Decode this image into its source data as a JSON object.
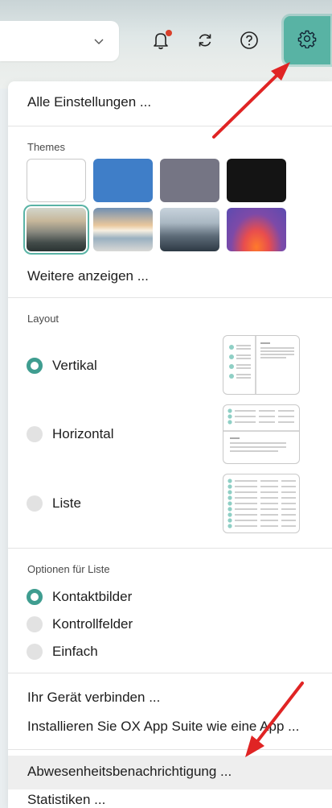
{
  "toolbar": {
    "search_dropdown": "chevron-down-icon",
    "notifications": "bell-icon",
    "refresh": "refresh-icon",
    "help": "help-icon",
    "settings": "gear-icon",
    "accent_color": "#58b3a4",
    "notification_dot_color": "#d9402b"
  },
  "menu": {
    "all_settings": "Alle Einstellungen ...",
    "themes": {
      "label": "Themes",
      "colors": [
        "#ffffff",
        "#3f7ec8",
        "#757584",
        "#141414"
      ],
      "images": [
        "mountains-fog",
        "beach-sunset",
        "city-skyline",
        "purple-orange-gradient"
      ],
      "selected": "mountains-fog"
    },
    "more_themes": "Weitere anzeigen ...",
    "layout": {
      "label": "Layout",
      "options": [
        {
          "label": "Vertikal",
          "selected": true
        },
        {
          "label": "Horizontal",
          "selected": false
        },
        {
          "label": "Liste",
          "selected": false
        }
      ]
    },
    "list_options": {
      "label": "Optionen für Liste",
      "options": [
        {
          "label": "Kontaktbilder",
          "selected": true
        },
        {
          "label": "Kontrollfelder",
          "selected": false
        },
        {
          "label": "Einfach",
          "selected": false
        }
      ]
    },
    "connect_device": "Ihr Gerät verbinden ...",
    "install_app": "Installieren Sie OX App Suite wie eine App ...",
    "out_of_office": "Abwesenheitsbenachrichtigung ...",
    "statistics": "Statistiken ..."
  },
  "annotation_color": "#e02424"
}
